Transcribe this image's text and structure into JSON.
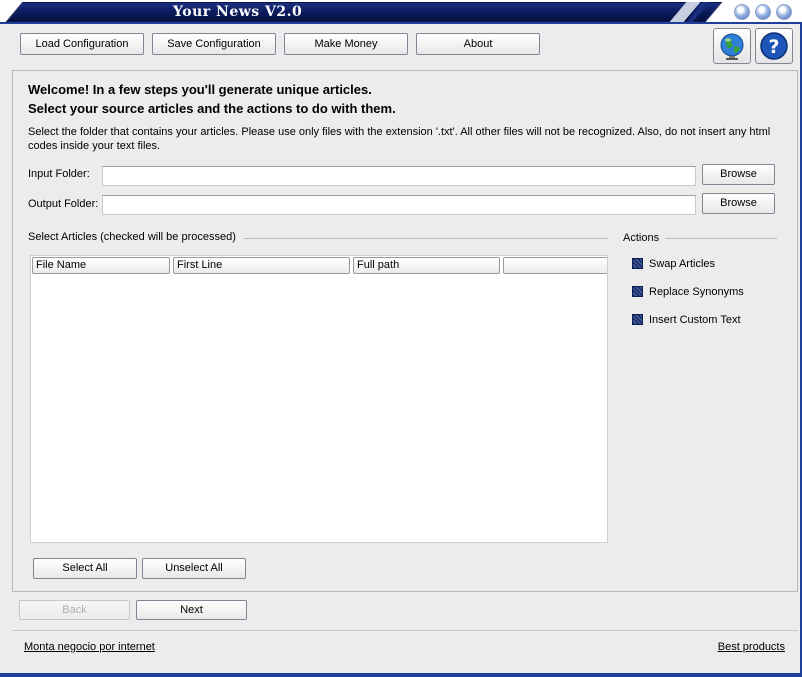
{
  "window": {
    "title": "Your News V2.0"
  },
  "toolbar": {
    "load_config": "Load Configuration",
    "save_config": "Save Configuration",
    "make_money": "Make Money",
    "about": "About",
    "globe_icon": "globe-icon",
    "help_icon": "help-icon"
  },
  "main": {
    "welcome_line1": "Welcome! In a few steps you'll generate unique articles.",
    "welcome_line2": "Select your source articles and the actions to do with them.",
    "instructions": "Select the folder that contains your articles. Please use only files with the extension '.txt'. All other files will not be recognized. Also, do not insert any html codes inside your text files.",
    "input_folder_label": "Input Folder:",
    "input_folder_value": "",
    "output_folder_label": "Output Folder:",
    "output_folder_value": "",
    "browse_label": "Browse",
    "select_articles_title": "Select Articles (checked will be processed)",
    "columns": [
      "File Name",
      "First Line",
      "Full path",
      ""
    ],
    "select_all": "Select All",
    "unselect_all": "Unselect All"
  },
  "actions": {
    "title": "Actions",
    "items": [
      "Swap Articles",
      "Replace Synonyms",
      "Insert Custom Text"
    ]
  },
  "wizard": {
    "back": "Back",
    "next": "Next"
  },
  "footer": {
    "left_link": "Monta negocio por internet",
    "right_link": "Best products"
  },
  "colors": {
    "titlebar": "#0b1a5a",
    "frame": "#1f3f9a",
    "background": "#ececec"
  }
}
